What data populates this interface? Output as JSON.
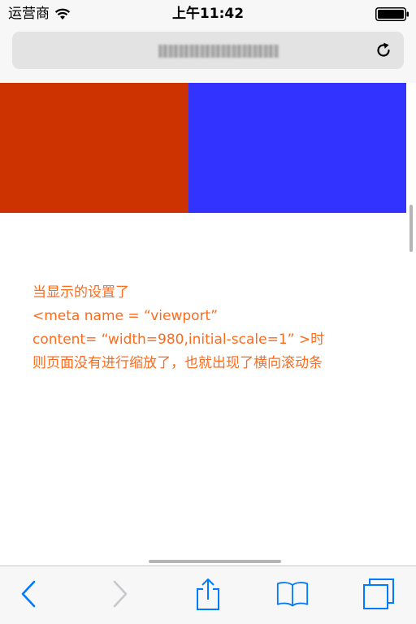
{
  "status_bar": {
    "carrier": "运营商",
    "time": "上午11:42",
    "wifi_icon": "wifi-icon",
    "battery_icon": "battery-icon"
  },
  "url_bar": {
    "url_text": "",
    "reload_icon": "reload-icon"
  },
  "page": {
    "note_lines": [
      "当显示的设置了",
      "<meta name = “viewport”",
      "content= “width=980,initial-scale=1” >时",
      "则页面没有进行缩放了，也就出现了横向滚动条"
    ],
    "colors": {
      "left_block": "#cc3300",
      "right_block": "#3333ff",
      "note_text": "#ff6a1a"
    }
  },
  "toolbar": {
    "icons": [
      "back-icon",
      "forward-icon",
      "share-icon",
      "bookmarks-icon",
      "tabs-icon"
    ],
    "accent": "#007aff"
  }
}
